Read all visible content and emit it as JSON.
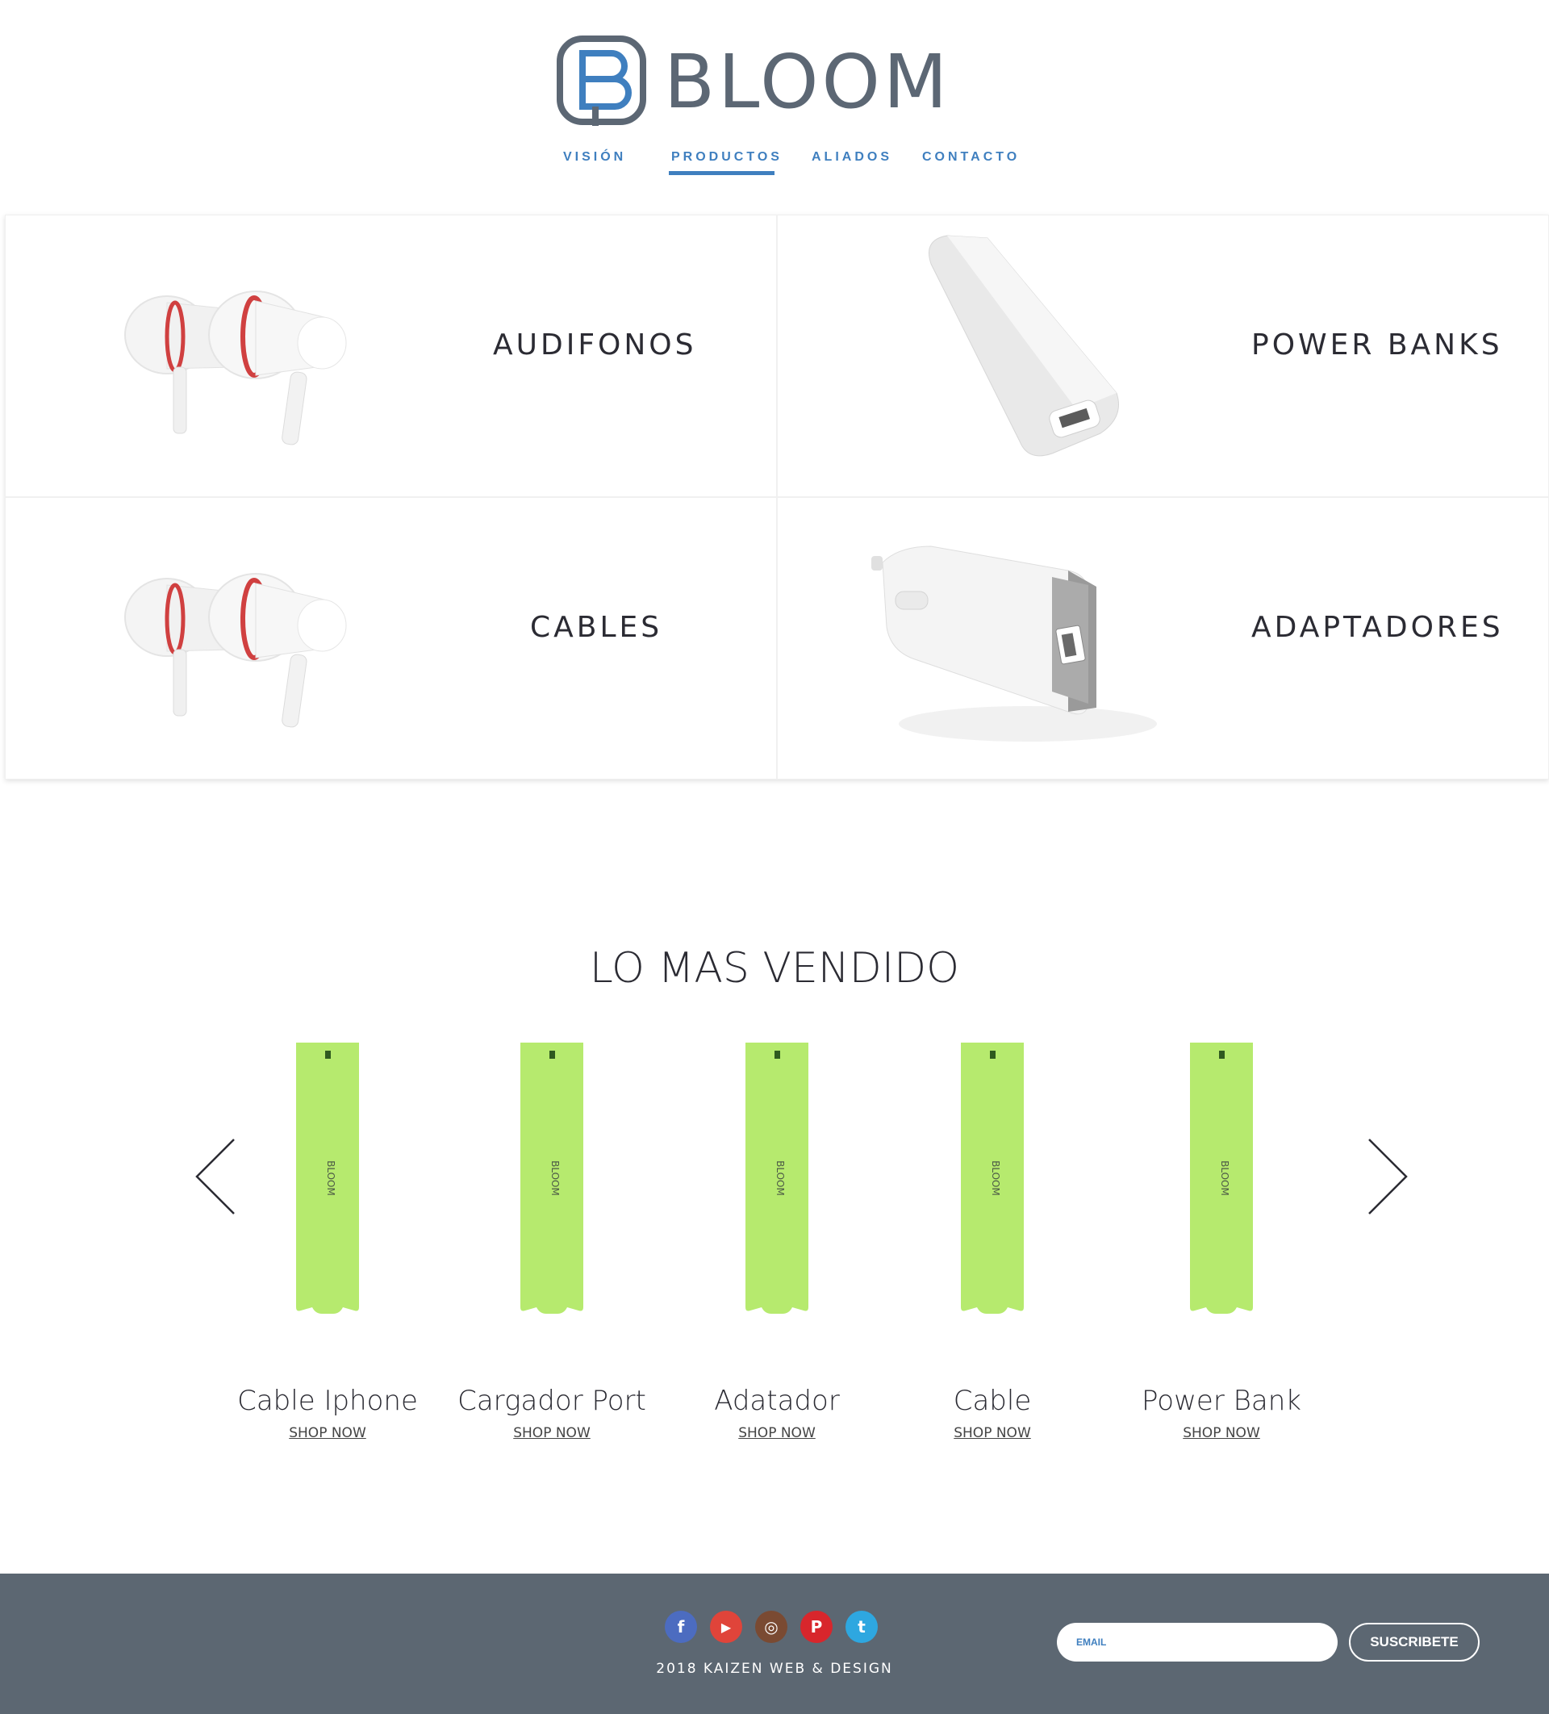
{
  "brand": {
    "name": "BLOOM",
    "logo_color": "#5c6774",
    "accent": "#3f7fbf"
  },
  "nav": {
    "items": [
      {
        "label": "VISIÓN",
        "active": false
      },
      {
        "label": "PRODUCTOS",
        "active": true
      },
      {
        "label": "ALIADOS",
        "active": false
      },
      {
        "label": "CONTACTO",
        "active": false
      }
    ]
  },
  "categories": [
    {
      "label": "AUDIFONOS",
      "image": "earphones"
    },
    {
      "label": "POWER BANKS",
      "image": "power-bank"
    },
    {
      "label": "CABLES",
      "image": "earphones"
    },
    {
      "label": "ADAPTADORES",
      "image": "car-adapter"
    }
  ],
  "best_sellers": {
    "title": "LO MAS VENDIDO",
    "items": [
      {
        "name": "Cable Iphone",
        "link": "SHOP NOW"
      },
      {
        "name": "Cargador Port",
        "link": "SHOP NOW"
      },
      {
        "name": "Adatador",
        "link": "SHOP NOW"
      },
      {
        "name": "Cable",
        "link": "SHOP NOW"
      },
      {
        "name": "Power Bank",
        "link": "SHOP NOW"
      }
    ],
    "product_color": "#b6ea6e",
    "prev_icon": "chevron-left-icon",
    "next_icon": "chevron-right-icon"
  },
  "footer": {
    "background": "#5c6772",
    "socials": [
      {
        "name": "facebook-icon",
        "glyph": "f",
        "color": "#4c6cc0"
      },
      {
        "name": "youtube-icon",
        "glyph": "▶",
        "color": "#e0443a"
      },
      {
        "name": "instagram-icon",
        "glyph": "◎",
        "color": "#7a4a32"
      },
      {
        "name": "pinterest-icon",
        "glyph": "P",
        "color": "#d8262c"
      },
      {
        "name": "twitter-icon",
        "glyph": "t",
        "color": "#2ea7e0"
      }
    ],
    "copyright": "2018 KAIZEN WEB & DESIGN",
    "email_placeholder": "EMAIL",
    "subscribe_label": "SUSCRIBETE"
  }
}
